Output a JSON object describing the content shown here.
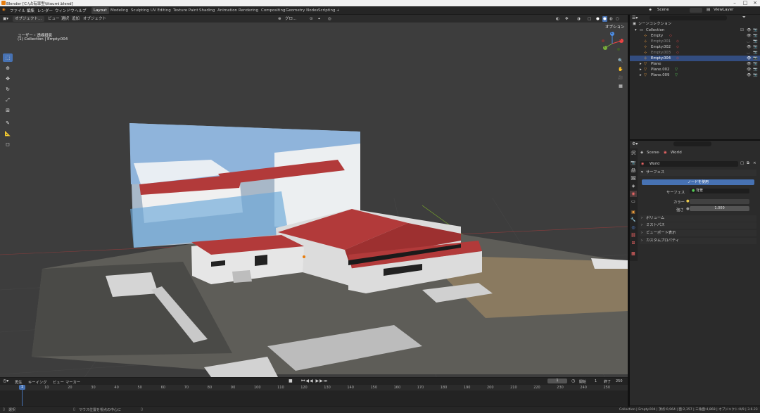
{
  "window": {
    "title": "Blender [C:\\占有率型\\iitoumi.blend]"
  },
  "menu": {
    "items": [
      "ファイル",
      "編集",
      "レンダー",
      "ウィンドウ",
      "ヘルプ"
    ]
  },
  "workspaces": [
    "Layout",
    "Modeling",
    "Sculpting",
    "UV Editing",
    "Texture Paint",
    "Shading",
    "Animation",
    "Rendering",
    "Compositing",
    "Geometry Nodes",
    "Scripting",
    "+"
  ],
  "scene_selector": {
    "scene": "Scene",
    "view_layer": "ViewLayer"
  },
  "viewport_header": {
    "mode": "オブジェクト…",
    "menus": [
      "ビュー",
      "選択",
      "追加",
      "オブジェクト"
    ],
    "transform": "グロ…",
    "options": "オプション"
  },
  "viewport": {
    "view_name": "ユーザー・透視投影",
    "collection_info": "(1) Collection | Empty.004",
    "axes": {
      "x": "X",
      "y": "Y",
      "z": "Z"
    }
  },
  "tools": [
    "select-cursor",
    "cursor",
    "move",
    "rotate",
    "scale",
    "transform",
    "annotate",
    "measure",
    "add-cube"
  ],
  "outliner": {
    "root": "シーンコレクション",
    "collection": "Collection",
    "items": [
      {
        "name": "Empty",
        "type": "empty"
      },
      {
        "name": "Empty.001",
        "type": "empty"
      },
      {
        "name": "Empty.002",
        "type": "empty"
      },
      {
        "name": "Empty.003",
        "type": "empty"
      },
      {
        "name": "Empty.004",
        "type": "empty"
      },
      {
        "name": "Plane",
        "type": "mesh"
      },
      {
        "name": "Plane.002",
        "type": "mesh"
      },
      {
        "name": "Plane.009",
        "type": "mesh"
      }
    ]
  },
  "properties": {
    "breadcrumb": {
      "scene": "Scene",
      "world": "World"
    },
    "world_name": "World",
    "surface_panel": "サーフェス",
    "use_nodes_button": "ノードを使用",
    "surface_label": "サーフェス",
    "surface_value": "背景",
    "color_label": "カラー",
    "strength_label": "強さ",
    "strength_value": "1.000",
    "subpanels": [
      "ボリューム",
      "ミストパス",
      "ビューポート表示",
      "カスタムプロパティ"
    ]
  },
  "timeline": {
    "menus": [
      "再生",
      "キーイング",
      "ビュー",
      "マーカー"
    ],
    "current_frame": "1",
    "start_label": "開始",
    "start": "1",
    "end_label": "終了",
    "end": "250",
    "ticks": [
      "0",
      "10",
      "20",
      "30",
      "40",
      "50",
      "60",
      "70",
      "80",
      "90",
      "100",
      "110",
      "120",
      "130",
      "140",
      "150",
      "160",
      "170",
      "180",
      "190",
      "200",
      "210",
      "220",
      "230",
      "240",
      "250"
    ]
  },
  "statusbar": {
    "left": "選択",
    "middle": "マウス位置を視点の中心に",
    "right": "Collection | Empty.004 | 頂点:0,964 | 面:2,357 | 三角面:4,868 | オブジェクト:0/9 | 3.6.23"
  },
  "colors": {
    "accent": "#4772b3",
    "selected_row": "#334d80",
    "roof": "#b03a3a",
    "background": "#3d3d3d"
  }
}
